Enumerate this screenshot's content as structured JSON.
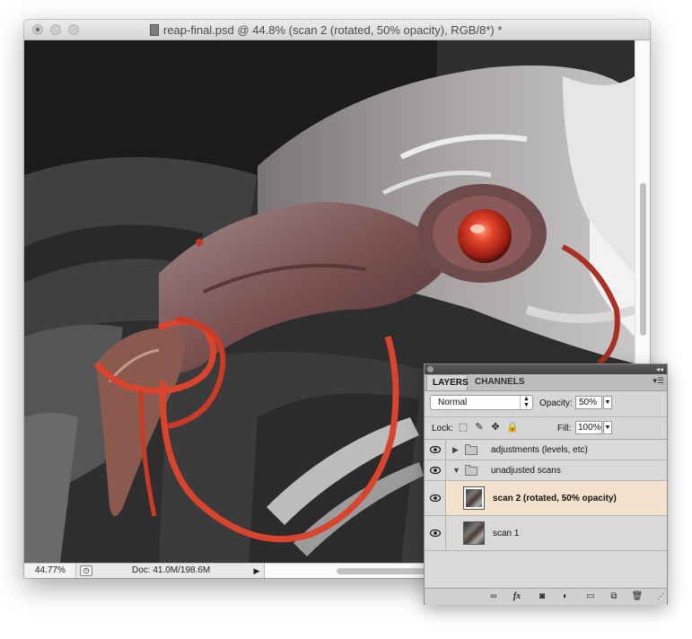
{
  "document": {
    "title": "reap-final.psd @ 44.8% (scan 2 (rotated, 50% opacity), RGB/8*) *",
    "zoom": "44.77%",
    "doc_info": "Doc: 41.0M/198.6M"
  },
  "layers_panel": {
    "tabs": [
      "LAYERS",
      "CHANNELS"
    ],
    "blend_mode": "Normal",
    "opacity_label": "Opacity:",
    "opacity_value": "50%",
    "lock_label": "Lock:",
    "fill_label": "Fill:",
    "fill_value": "100%",
    "layers": [
      {
        "name": "adjustments (levels, etc)",
        "type": "group",
        "expanded": false
      },
      {
        "name": "unadjusted scans",
        "type": "group",
        "expanded": true
      },
      {
        "name": "scan 2 (rotated, 50% opacity)",
        "type": "layer",
        "selected": true
      },
      {
        "name": "scan 1",
        "type": "layer",
        "selected": false
      }
    ]
  },
  "icons": [
    "eye-icon",
    "link-icon",
    "fx-icon",
    "mask-icon",
    "adjustment-icon",
    "new-group-icon",
    "new-layer-icon",
    "trash-icon"
  ],
  "colors": {
    "selected_layer_bg": "#f2e2cc",
    "cord_red": "#d9442e",
    "eye_red": "#c8321e"
  }
}
